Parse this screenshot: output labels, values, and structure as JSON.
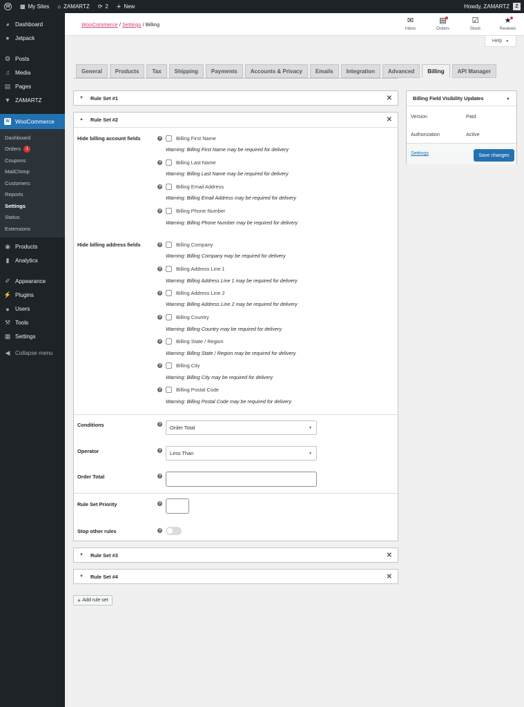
{
  "adminbar": {
    "my_sites": "My Sites",
    "site_name": "ZAMARTZ",
    "updates_count": "2",
    "new_label": "New",
    "howdy": "Howdy, ZAMARTZ"
  },
  "sidebar": {
    "items_top": [
      {
        "label": "Dashboard",
        "icon": "dashboard-icon"
      },
      {
        "label": "Jetpack",
        "icon": "jetpack-icon"
      }
    ],
    "items_mid": [
      {
        "label": "Posts",
        "icon": "pin-icon"
      },
      {
        "label": "Media",
        "icon": "media-icon"
      },
      {
        "label": "Pages",
        "icon": "pages-icon"
      },
      {
        "label": "ZAMARTZ",
        "icon": "zamartz-icon"
      }
    ],
    "woocommerce": "WooCommerce",
    "submenu": [
      {
        "label": "Dashboard"
      },
      {
        "label": "Orders",
        "badge": "1"
      },
      {
        "label": "Coupons"
      },
      {
        "label": "MailChimp"
      },
      {
        "label": "Customers"
      },
      {
        "label": "Reports"
      },
      {
        "label": "Settings",
        "current": true
      },
      {
        "label": "Status"
      },
      {
        "label": "Extensions"
      }
    ],
    "items_bottom": [
      {
        "label": "Products"
      },
      {
        "label": "Analytics"
      },
      {
        "label": "Appearance"
      },
      {
        "label": "Plugins"
      },
      {
        "label": "Users"
      },
      {
        "label": "Tools"
      },
      {
        "label": "Settings"
      }
    ],
    "collapse": "Collapse menu"
  },
  "header": {
    "breadcrumb": {
      "woocommerce": "WooCommerce",
      "settings": "Settings",
      "current": "Billing",
      "sep": "/"
    },
    "icons": [
      {
        "label": "Inbox",
        "icon": "inbox-icon",
        "dot": false
      },
      {
        "label": "Orders",
        "icon": "orders-icon",
        "dot": true
      },
      {
        "label": "Stock",
        "icon": "stock-icon",
        "dot": false
      },
      {
        "label": "Reviews",
        "icon": "star-icon",
        "dot": true
      }
    ],
    "help": "Help"
  },
  "tabs": [
    "General",
    "Products",
    "Tax",
    "Shipping",
    "Payments",
    "Accounts & Privacy",
    "Emails",
    "Integration",
    "Advanced",
    "Billing",
    "API Manager"
  ],
  "active_tab": "Billing",
  "rulesets": {
    "rs1": "Rule Set #1",
    "rs2": "Rule Set #2",
    "rs3": "Rule Set #3",
    "rs4": "Rule Set #4"
  },
  "rs2": {
    "account_label": "Hide billing account fields",
    "account_fields": [
      {
        "label": "Billing First Name",
        "warning": "Warning: Billing First Name may be required for delivery"
      },
      {
        "label": "Billing Last Name",
        "warning": "Warning: Billing Last Name may be required for delivery"
      },
      {
        "label": "Billing Email Address",
        "warning": "Warning: Billing Email Address may be required for delivery"
      },
      {
        "label": "Billing Phone Number",
        "warning": "Warning: Billing Phone Number may be required for delivery"
      }
    ],
    "address_label": "Hide billing address fields",
    "address_fields": [
      {
        "label": "Billing Company",
        "warning": "Warning: Billing Company may be required for delivery"
      },
      {
        "label": "Billing Address Line 1",
        "warning": "Warning: Billing Address Line 1 may be required for delivery"
      },
      {
        "label": "Billing Address Line 2",
        "warning": "Warning: Billing Address Line 2 may be required for delivery"
      },
      {
        "label": "Billing Country",
        "warning": "Warning: Billing Country may be required for delivery"
      },
      {
        "label": "Billing State / Region",
        "warning": "Warning: Billing State / Region may be required for delivery"
      },
      {
        "label": "Billing City",
        "warning": "Warning: Billing City may be required for delivery"
      },
      {
        "label": "Billing Postal Code",
        "warning": "Warning: Billing Postal Code may be required for delivery"
      }
    ],
    "conditions_label": "Conditions",
    "conditions_value": "Order Total",
    "operator_label": "Operator",
    "operator_value": "Less Than",
    "order_total_label": "Order Total",
    "order_total_value": "",
    "priority_label": "Rule Set Priority",
    "priority_value": "",
    "stop_label": "Stop other rules",
    "stop_enabled": false
  },
  "sidebox": {
    "title": "Billing Field Visibility Updates",
    "version_label": "Version",
    "version_value": "Paid",
    "auth_label": "Authorization",
    "auth_value": "Active",
    "settings_link": "Settings",
    "save_button": "Save changes"
  },
  "add_rule_set": "Add rule set"
}
